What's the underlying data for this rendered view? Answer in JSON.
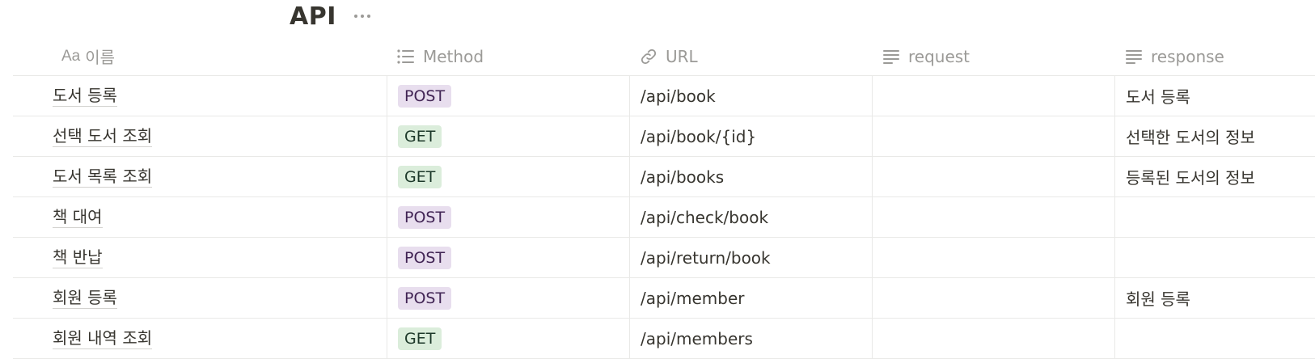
{
  "page": {
    "title": "API"
  },
  "columns": [
    {
      "label": "이름",
      "icon": "title-icon"
    },
    {
      "label": "Method",
      "icon": "list-icon"
    },
    {
      "label": "URL",
      "icon": "link-icon"
    },
    {
      "label": "request",
      "icon": "text-icon"
    },
    {
      "label": "response",
      "icon": "text-icon"
    }
  ],
  "title_icon_text": "Aa",
  "tag_colors": {
    "POST": {
      "bg": "#e8deee",
      "fg": "#412454"
    },
    "GET": {
      "bg": "#dbeddb",
      "fg": "#1c3829"
    }
  },
  "rows": [
    {
      "name": "도서 등록",
      "method": "POST",
      "url": "/api/book",
      "request": "",
      "response": "도서 등록"
    },
    {
      "name": "선택 도서 조회",
      "method": "GET",
      "url": "/api/book/{id}",
      "request": "",
      "response": "선택한 도서의 정보"
    },
    {
      "name": "도서 목록 조회",
      "method": "GET",
      "url": "/api/books",
      "request": "",
      "response": "등록된 도서의 정보"
    },
    {
      "name": "책 대여",
      "method": "POST",
      "url": "/api/check/book",
      "request": "",
      "response": ""
    },
    {
      "name": "책 반납",
      "method": "POST",
      "url": "/api/return/book",
      "request": "",
      "response": ""
    },
    {
      "name": "회원 등록",
      "method": "POST",
      "url": "/api/member",
      "request": "",
      "response": "회원 등록"
    },
    {
      "name": "회원 내역 조회",
      "method": "GET",
      "url": "/api/members",
      "request": "",
      "response": ""
    }
  ]
}
